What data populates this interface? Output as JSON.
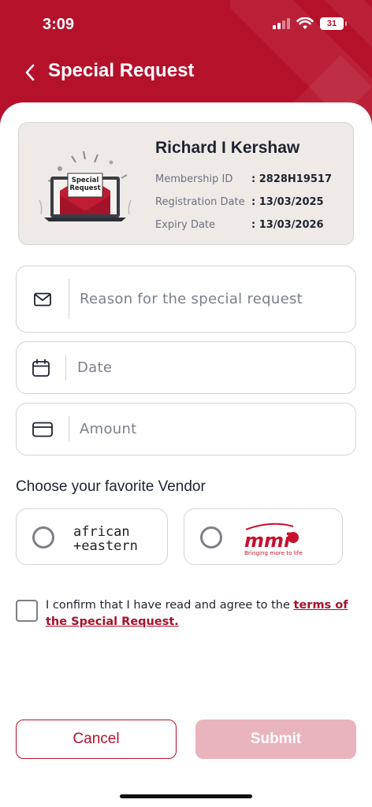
{
  "status_bar": {
    "time": "3:09",
    "battery": "31"
  },
  "header": {
    "title": "Special Request"
  },
  "member_card": {
    "illustration_text": [
      "Special",
      "Request"
    ],
    "name": "Richard I Kershaw",
    "rows": [
      {
        "label": "Membership ID",
        "value": ": 2828H19517"
      },
      {
        "label": "Registration Date",
        "value": ": 13/03/2025"
      },
      {
        "label": "Expiry Date",
        "value": ": 13/03/2026"
      }
    ]
  },
  "form": {
    "reason_placeholder": "Reason for the special request",
    "date_placeholder": "Date",
    "amount_placeholder": "Amount"
  },
  "vendors": {
    "title": "Choose your favorite Vendor",
    "items": [
      {
        "name": "african + eastern",
        "logo_line1": "african",
        "logo_line2": "+eastern"
      },
      {
        "name": "mmi",
        "logo_text": "mmi",
        "tagline": "Bringing more to life"
      }
    ]
  },
  "terms": {
    "text": "I confirm that I have read and agree to the ",
    "link": "terms of the Special Request."
  },
  "actions": {
    "cancel": "Cancel",
    "submit": "Submit"
  },
  "colors": {
    "brand": "#b5112b",
    "submit_disabled": "#eab4be",
    "card_bg": "#efeae6"
  }
}
